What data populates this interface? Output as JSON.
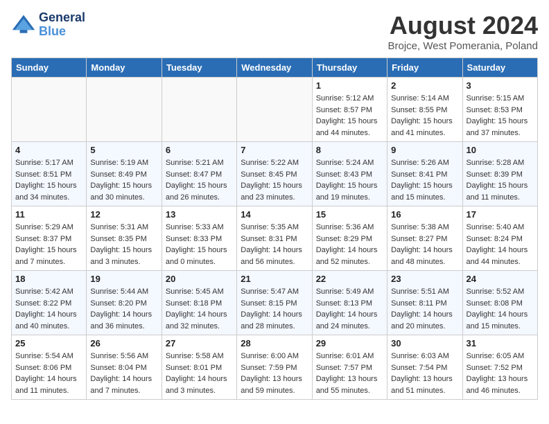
{
  "header": {
    "logo_line1": "General",
    "logo_line2": "Blue",
    "month_title": "August 2024",
    "subtitle": "Brojce, West Pomerania, Poland"
  },
  "weekdays": [
    "Sunday",
    "Monday",
    "Tuesday",
    "Wednesday",
    "Thursday",
    "Friday",
    "Saturday"
  ],
  "weeks": [
    [
      {
        "day": null
      },
      {
        "day": null
      },
      {
        "day": null
      },
      {
        "day": null
      },
      {
        "day": 1,
        "sunrise": "5:12 AM",
        "sunset": "8:57 PM",
        "daylight": "15 hours and 44 minutes."
      },
      {
        "day": 2,
        "sunrise": "5:14 AM",
        "sunset": "8:55 PM",
        "daylight": "15 hours and 41 minutes."
      },
      {
        "day": 3,
        "sunrise": "5:15 AM",
        "sunset": "8:53 PM",
        "daylight": "15 hours and 37 minutes."
      }
    ],
    [
      {
        "day": 4,
        "sunrise": "5:17 AM",
        "sunset": "8:51 PM",
        "daylight": "15 hours and 34 minutes."
      },
      {
        "day": 5,
        "sunrise": "5:19 AM",
        "sunset": "8:49 PM",
        "daylight": "15 hours and 30 minutes."
      },
      {
        "day": 6,
        "sunrise": "5:21 AM",
        "sunset": "8:47 PM",
        "daylight": "15 hours and 26 minutes."
      },
      {
        "day": 7,
        "sunrise": "5:22 AM",
        "sunset": "8:45 PM",
        "daylight": "15 hours and 23 minutes."
      },
      {
        "day": 8,
        "sunrise": "5:24 AM",
        "sunset": "8:43 PM",
        "daylight": "15 hours and 19 minutes."
      },
      {
        "day": 9,
        "sunrise": "5:26 AM",
        "sunset": "8:41 PM",
        "daylight": "15 hours and 15 minutes."
      },
      {
        "day": 10,
        "sunrise": "5:28 AM",
        "sunset": "8:39 PM",
        "daylight": "15 hours and 11 minutes."
      }
    ],
    [
      {
        "day": 11,
        "sunrise": "5:29 AM",
        "sunset": "8:37 PM",
        "daylight": "15 hours and 7 minutes."
      },
      {
        "day": 12,
        "sunrise": "5:31 AM",
        "sunset": "8:35 PM",
        "daylight": "15 hours and 3 minutes."
      },
      {
        "day": 13,
        "sunrise": "5:33 AM",
        "sunset": "8:33 PM",
        "daylight": "15 hours and 0 minutes."
      },
      {
        "day": 14,
        "sunrise": "5:35 AM",
        "sunset": "8:31 PM",
        "daylight": "14 hours and 56 minutes."
      },
      {
        "day": 15,
        "sunrise": "5:36 AM",
        "sunset": "8:29 PM",
        "daylight": "14 hours and 52 minutes."
      },
      {
        "day": 16,
        "sunrise": "5:38 AM",
        "sunset": "8:27 PM",
        "daylight": "14 hours and 48 minutes."
      },
      {
        "day": 17,
        "sunrise": "5:40 AM",
        "sunset": "8:24 PM",
        "daylight": "14 hours and 44 minutes."
      }
    ],
    [
      {
        "day": 18,
        "sunrise": "5:42 AM",
        "sunset": "8:22 PM",
        "daylight": "14 hours and 40 minutes."
      },
      {
        "day": 19,
        "sunrise": "5:44 AM",
        "sunset": "8:20 PM",
        "daylight": "14 hours and 36 minutes."
      },
      {
        "day": 20,
        "sunrise": "5:45 AM",
        "sunset": "8:18 PM",
        "daylight": "14 hours and 32 minutes."
      },
      {
        "day": 21,
        "sunrise": "5:47 AM",
        "sunset": "8:15 PM",
        "daylight": "14 hours and 28 minutes."
      },
      {
        "day": 22,
        "sunrise": "5:49 AM",
        "sunset": "8:13 PM",
        "daylight": "14 hours and 24 minutes."
      },
      {
        "day": 23,
        "sunrise": "5:51 AM",
        "sunset": "8:11 PM",
        "daylight": "14 hours and 20 minutes."
      },
      {
        "day": 24,
        "sunrise": "5:52 AM",
        "sunset": "8:08 PM",
        "daylight": "14 hours and 15 minutes."
      }
    ],
    [
      {
        "day": 25,
        "sunrise": "5:54 AM",
        "sunset": "8:06 PM",
        "daylight": "14 hours and 11 minutes."
      },
      {
        "day": 26,
        "sunrise": "5:56 AM",
        "sunset": "8:04 PM",
        "daylight": "14 hours and 7 minutes."
      },
      {
        "day": 27,
        "sunrise": "5:58 AM",
        "sunset": "8:01 PM",
        "daylight": "14 hours and 3 minutes."
      },
      {
        "day": 28,
        "sunrise": "6:00 AM",
        "sunset": "7:59 PM",
        "daylight": "13 hours and 59 minutes."
      },
      {
        "day": 29,
        "sunrise": "6:01 AM",
        "sunset": "7:57 PM",
        "daylight": "13 hours and 55 minutes."
      },
      {
        "day": 30,
        "sunrise": "6:03 AM",
        "sunset": "7:54 PM",
        "daylight": "13 hours and 51 minutes."
      },
      {
        "day": 31,
        "sunrise": "6:05 AM",
        "sunset": "7:52 PM",
        "daylight": "13 hours and 46 minutes."
      }
    ]
  ],
  "labels": {
    "sunrise": "Sunrise:",
    "sunset": "Sunset:",
    "daylight": "Daylight hours"
  }
}
